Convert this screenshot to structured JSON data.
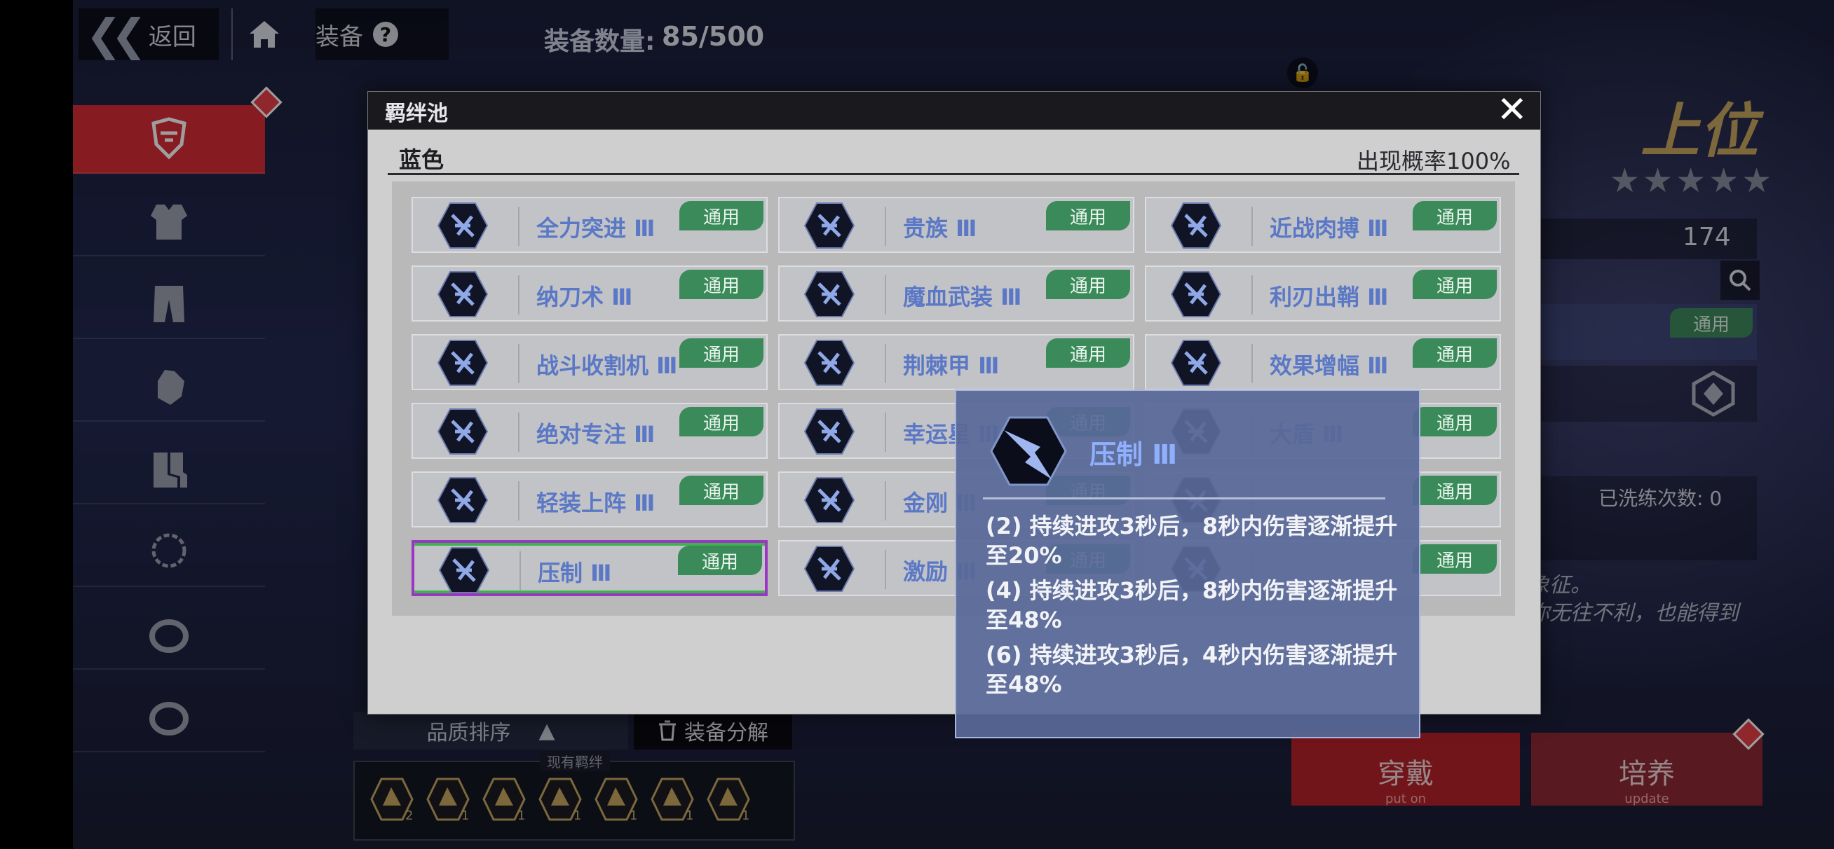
{
  "topbar": {
    "back_label": "返回",
    "equip_title": "装备",
    "count_label": "装备数量:",
    "count_value": "85/500"
  },
  "right_panel": {
    "rank": "上位",
    "stars": "★★★★★",
    "stat_value": "174",
    "badge": "通用",
    "wash_label": "已洗练次数: 0",
    "desc_line1": "象征。",
    "desc_line2": "你无往不利，也能得到",
    "put_on": "穿戴",
    "put_on_sub": "put on",
    "train": "培养",
    "train_sub": "update"
  },
  "bottom": {
    "sort_label": "品质排序",
    "dismantle_label": "装备分解",
    "bonds_label": "现有羁绊",
    "bond_counts": [
      "2",
      "1",
      "1",
      "1",
      "1",
      "1",
      "1"
    ]
  },
  "modal": {
    "title": "羁绊池",
    "section_name": "蓝色",
    "section_rate": "出现概率100%",
    "badge": "通用",
    "cards": [
      {
        "name": "全力突进 Ⅲ",
        "icon": "dash-icon"
      },
      {
        "name": "贵族 Ⅲ",
        "icon": "crown-icon"
      },
      {
        "name": "近战肉搏 Ⅲ",
        "icon": "fist-icon"
      },
      {
        "name": "纳刀术 Ⅲ",
        "icon": "sheath-icon"
      },
      {
        "name": "魔血武装 Ⅲ",
        "icon": "blood-icon"
      },
      {
        "name": "利刃出鞘 Ⅲ",
        "icon": "blade-icon"
      },
      {
        "name": "战斗收割机 Ⅲ",
        "icon": "saw-icon"
      },
      {
        "name": "荆棘甲 Ⅲ",
        "icon": "thorn-icon"
      },
      {
        "name": "效果增幅 Ⅲ",
        "icon": "amplify-icon"
      },
      {
        "name": "绝对专注 Ⅲ",
        "icon": "focus-icon"
      },
      {
        "name": "幸运星 Ⅲ",
        "icon": "star-icon"
      },
      {
        "name": "大盾 Ⅲ",
        "icon": "shield-icon"
      },
      {
        "name": "轻装上阵 Ⅲ",
        "icon": "boot-icon"
      },
      {
        "name": "金刚 Ⅲ",
        "icon": "figure-icon"
      },
      {
        "name": "",
        "icon": "ring-icon"
      },
      {
        "name": "压制 Ⅲ",
        "icon": "suppress-icon"
      },
      {
        "name": "激励 Ⅲ",
        "icon": "medal-icon"
      },
      {
        "name": "",
        "icon": "eye-icon"
      }
    ]
  },
  "tooltip": {
    "title": "压制 Ⅲ",
    "lines": [
      "(2) 持续进攻3秒后，8秒内伤害逐渐提升至20%",
      "(4) 持续进攻3秒后，8秒内伤害逐渐提升至48%",
      "(6) 持续进攻3秒后，4秒内伤害逐渐提升至48%"
    ]
  },
  "colors": {
    "accent_red": "#d82c36",
    "badge_green": "#3b8a59",
    "card_name_blue": "#5a78c6",
    "selected_border": "#9b35c4",
    "tooltip_bg": "#5868a0"
  }
}
